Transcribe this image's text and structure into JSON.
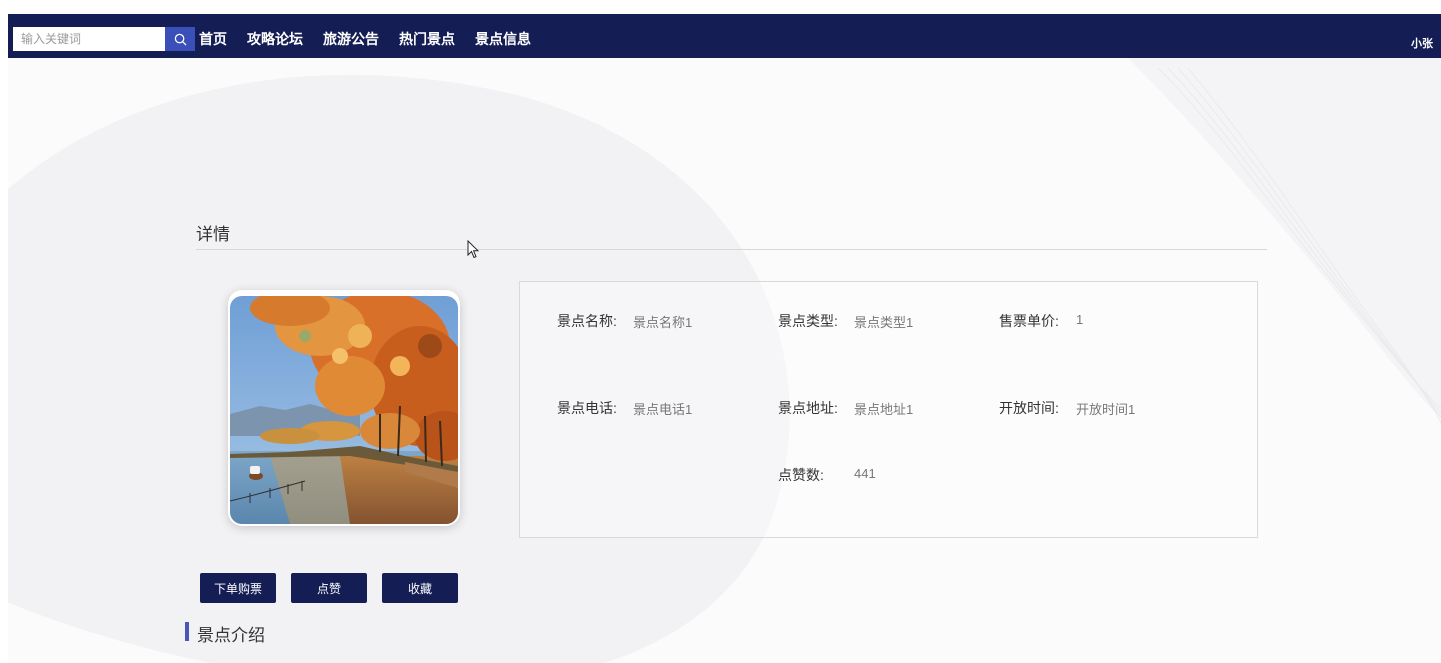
{
  "header": {
    "search_placeholder": "输入关键词",
    "nav": [
      "首页",
      "攻略论坛",
      "旅游公告",
      "热门景点",
      "景点信息"
    ],
    "user": "小张"
  },
  "detail": {
    "title": "详情",
    "fields": {
      "name_label": "景点名称:",
      "name_value": "景点名称1",
      "type_label": "景点类型:",
      "type_value": "景点类型1",
      "price_label": "售票单价:",
      "price_value": "1",
      "phone_label": "景点电话:",
      "phone_value": "景点电话1",
      "address_label": "景点地址:",
      "address_value": "景点地址1",
      "hours_label": "开放时间:",
      "hours_value": "开放时间1",
      "likes_label": "点赞数:",
      "likes_value": "441"
    },
    "buttons": {
      "buy": "下单购票",
      "like": "点赞",
      "favorite": "收藏"
    }
  },
  "intro": {
    "title": "景点介绍"
  },
  "colors": {
    "navbar": "#141d54",
    "search_button": "#3b4fb8",
    "accent_bar": "#4a56b8"
  }
}
